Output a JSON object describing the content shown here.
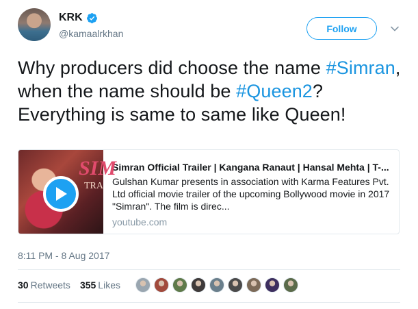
{
  "tweet": {
    "display_name": "KRK",
    "handle": "@kamaalrkhan",
    "follow_label": "Follow",
    "text_parts": {
      "p1": "Why producers did choose the name ",
      "h1": "#Simran",
      "p2": ", when the name should be ",
      "h2": "#Queen2",
      "p3": "? Everything is same to same like Queen!"
    },
    "timestamp": "8:11 PM - 8 Aug 2017"
  },
  "card": {
    "title": "Simran Official Trailer | Kangana Ranaut | Hansal Mehta | T-...",
    "description": "Gulshan Kumar presents in association with Karma Features Pvt. Ltd official movie trailer of the upcoming Bollywood movie in 2017 \"Simran\". The film is direc...",
    "domain": "youtube.com",
    "thumb_title": "SIM",
    "thumb_sub": "TRA"
  },
  "stats": {
    "retweets_count": "30",
    "retweets_label": "Retweets",
    "likes_count": "355",
    "likes_label": "Likes"
  },
  "likers": [
    {
      "icon": "avatar-icon",
      "color": "#9aa6b0"
    },
    {
      "icon": "avatar-icon",
      "color": "#a14a3c"
    },
    {
      "icon": "avatar-icon",
      "color": "#5f7a4a"
    },
    {
      "icon": "avatar-icon",
      "color": "#3e3a3a"
    },
    {
      "icon": "avatar-icon",
      "color": "#6a7f8c"
    },
    {
      "icon": "avatar-icon",
      "color": "#4a4a4a"
    },
    {
      "icon": "avatar-icon",
      "color": "#7c6a58"
    },
    {
      "icon": "avatar-icon",
      "color": "#3d2f5f"
    },
    {
      "icon": "avatar-icon",
      "color": "#5b6b4a"
    }
  ],
  "colors": {
    "accent": "#1da1f2",
    "hashtag": "#1b95e0",
    "muted": "#657786"
  }
}
